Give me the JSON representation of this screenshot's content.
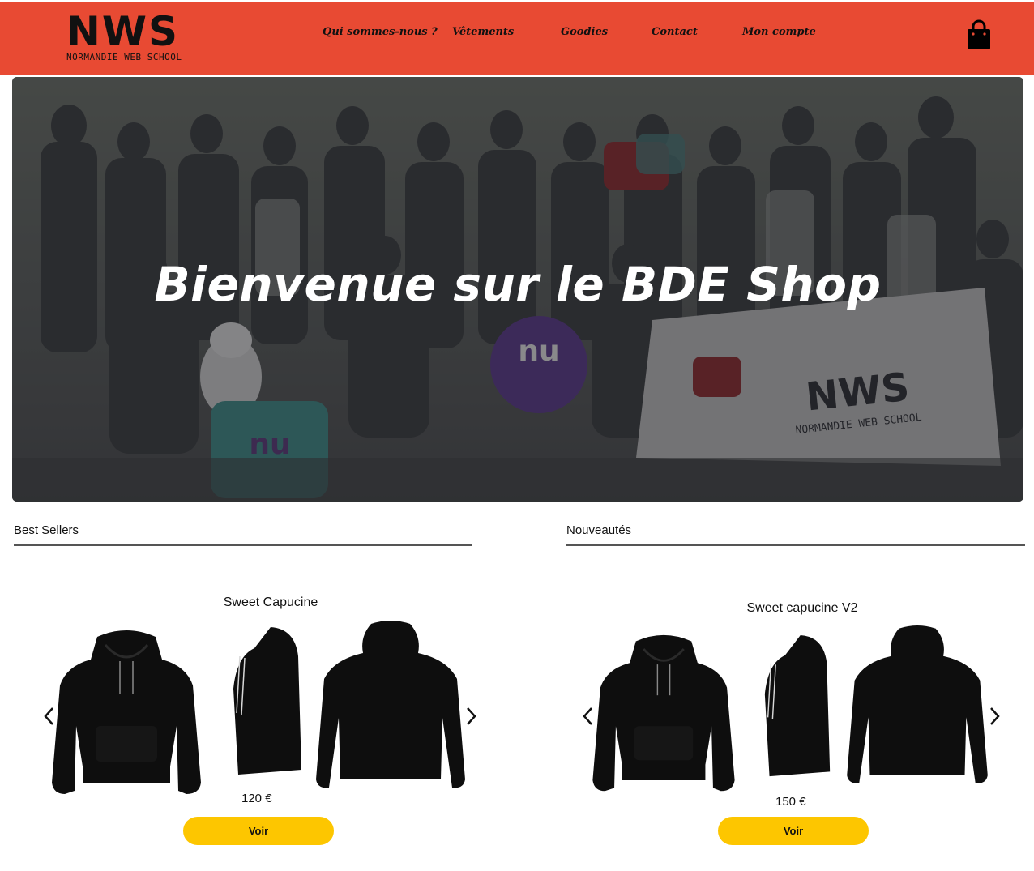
{
  "header": {
    "logo_mark": "NWS",
    "logo_sub": "NORMANDIE WEB SCHOOL",
    "nav": [
      {
        "label": "Qui sommes-nous ?"
      },
      {
        "label": "Vêtements"
      },
      {
        "label": "Goodies"
      },
      {
        "label": "Contact"
      },
      {
        "label": "Mon compte"
      }
    ],
    "cart_icon": "shopping-bag-icon",
    "accent_color": "#e84a33"
  },
  "hero": {
    "title": "Bienvenue sur le BDE Shop"
  },
  "sections": [
    {
      "title": "Best Sellers",
      "product": {
        "name": "Sweet Capucine",
        "price": "120 €",
        "button": "Voir"
      }
    },
    {
      "title": "Nouveautés",
      "product": {
        "name": "Sweet capucine V2",
        "price": "150 €",
        "button": "Voir"
      }
    }
  ],
  "colors": {
    "button": "#fdc600",
    "header": "#e84a33"
  }
}
